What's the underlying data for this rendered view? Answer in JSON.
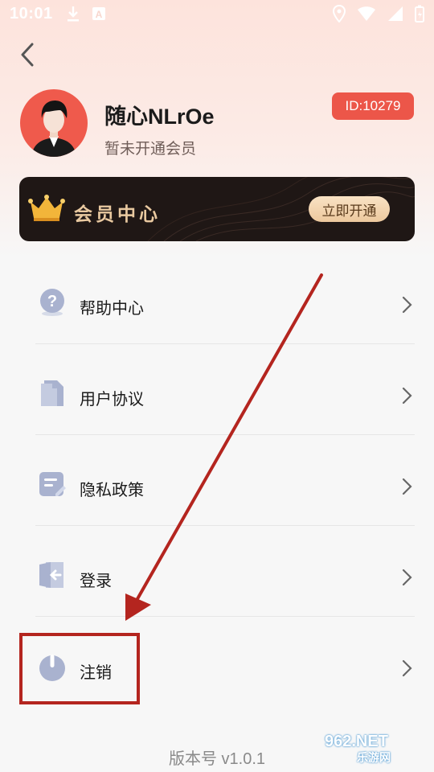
{
  "status_bar": {
    "time": "10:01"
  },
  "profile": {
    "username": "随心NLrOe",
    "member_status": "暂未开通会员",
    "id_badge": "ID:10279"
  },
  "vip_card": {
    "title": "会员中心",
    "button_label": "立即开通"
  },
  "menu": {
    "items": [
      {
        "label": "帮助中心",
        "icon": "help-icon"
      },
      {
        "label": "用户协议",
        "icon": "document-icon"
      },
      {
        "label": "隐私政策",
        "icon": "privacy-icon"
      },
      {
        "label": "登录",
        "icon": "login-icon"
      },
      {
        "label": "注销",
        "icon": "power-icon"
      }
    ]
  },
  "footer": {
    "version": "版本号 v1.0.1"
  },
  "watermark": {
    "text": "962.NET",
    "sub": "乐游网"
  },
  "colors": {
    "accent_red": "#ec5649",
    "annotation_red": "#b4251f",
    "vip_gold": "#e9c9a0"
  }
}
